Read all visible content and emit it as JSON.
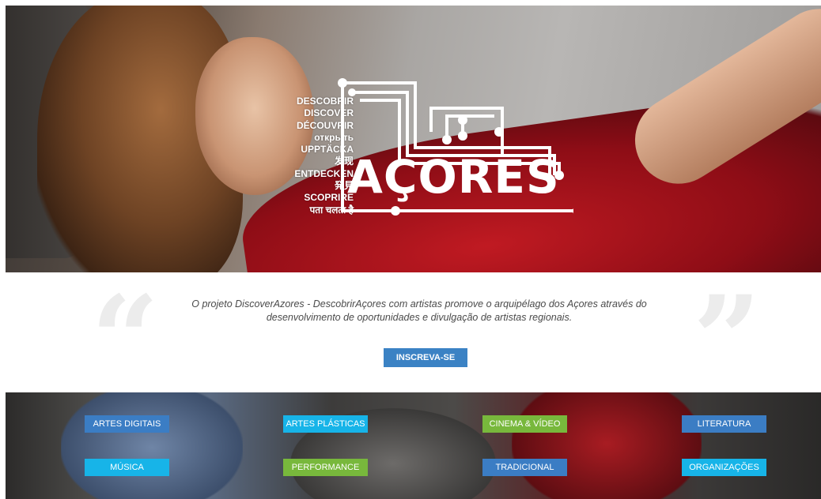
{
  "hero": {
    "words": [
      "DESCOBRIR",
      "DISCOVER",
      "DÉCOUVRIR",
      "открыть",
      "UPPTÄCKA",
      "发现",
      "ENTDECKEN",
      "発見",
      "SCOPRIRE",
      "पता चलता है"
    ],
    "logo_text": "AÇORES"
  },
  "intro": {
    "text": "O projeto DiscoverAzores - DescobrirAçores com artistas promove o arquipélago dos Açores através do desenvolvimento de oportunidades e divulgação de artistas regionais.",
    "subscribe_label": "INSCREVA-SE"
  },
  "categories": [
    {
      "label": "ARTES DIGITAIS",
      "color": "#3b7dc4"
    },
    {
      "label": "ARTES PLÁSTICAS",
      "color": "#17b4e8"
    },
    {
      "label": "CINEMA & VÍDEO",
      "color": "#78b83c"
    },
    {
      "label": "LITERATURA",
      "color": "#3b7dc4"
    },
    {
      "label": "MÚSICA",
      "color": "#17b4e8"
    },
    {
      "label": "PERFORMANCE",
      "color": "#78b83c"
    },
    {
      "label": "TRADICIONAL",
      "color": "#3b7dc4"
    },
    {
      "label": "ORGANIZAÇÕES",
      "color": "#17b4e8"
    }
  ]
}
